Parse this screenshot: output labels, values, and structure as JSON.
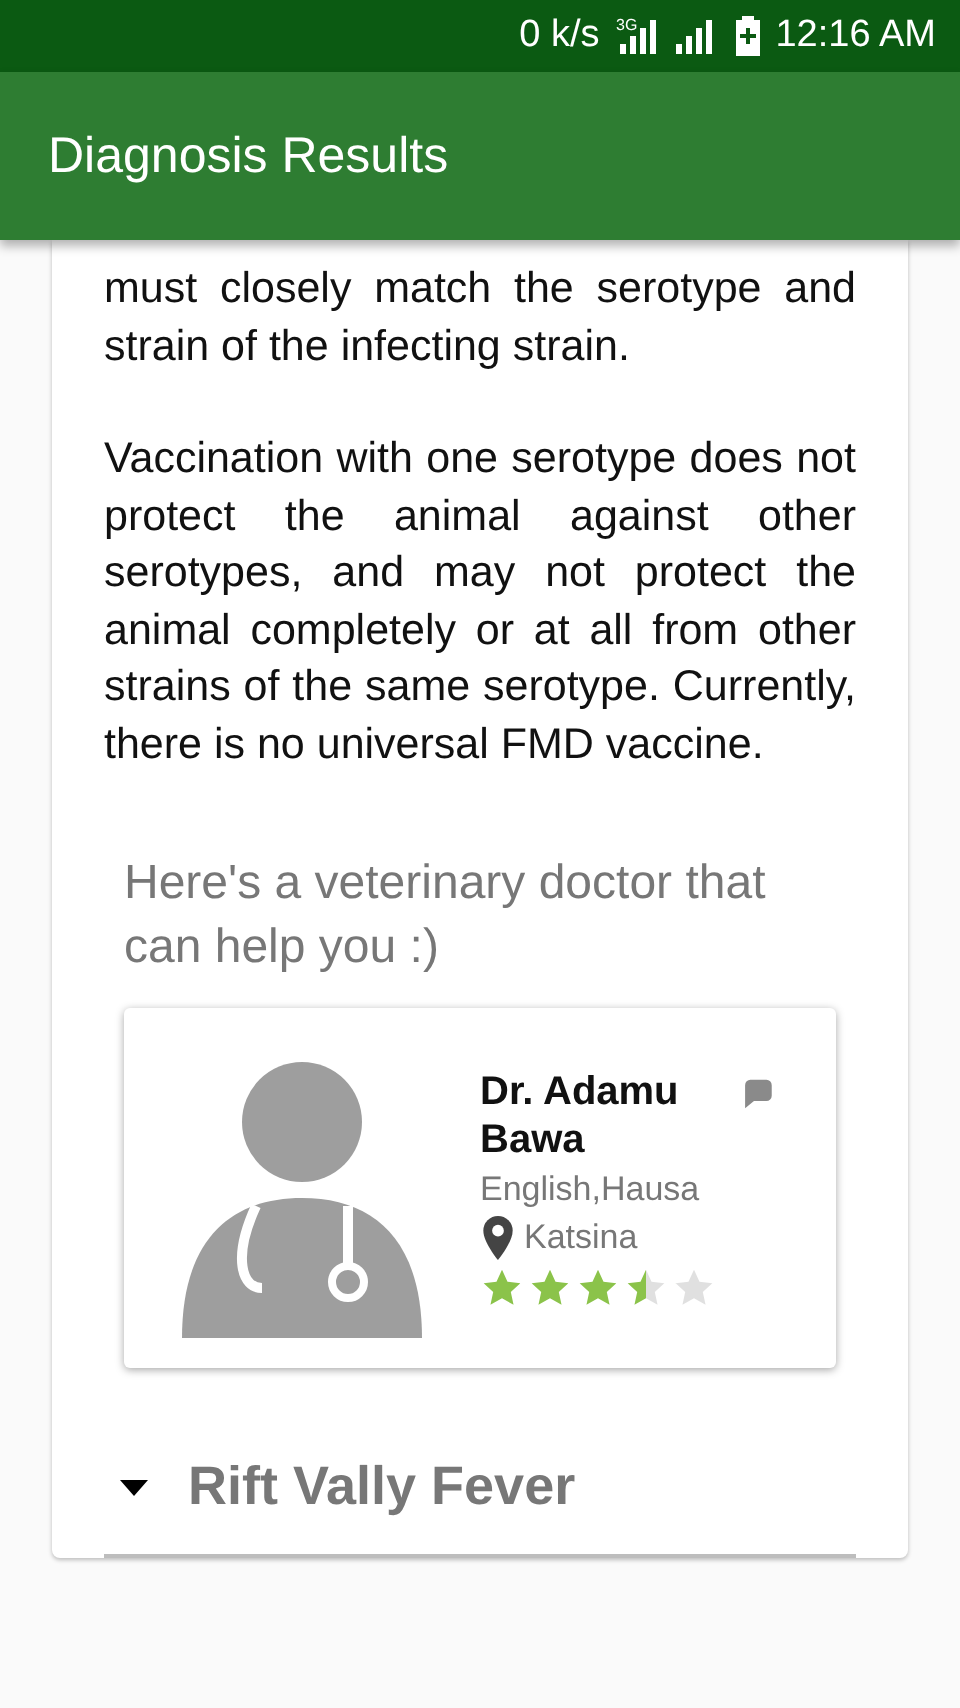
{
  "status_bar": {
    "speed": "0 k/s",
    "network": "3G",
    "time": "12:16 AM"
  },
  "app_bar": {
    "title": "Diagnosis Results"
  },
  "paragraphs": [
    "must closely match the serotype and strain of the infecting strain.",
    "Vaccination with one serotype does not protect the animal against other serotypes, and may not protect the animal completely or at all from other strains of the same serotype. Currently, there is no universal FMD vaccine."
  ],
  "doctor_section": {
    "heading": "Here's a veterinary doctor that can help you :)",
    "doctor": {
      "name": "Dr. Adamu Bawa",
      "languages": "English,Hausa",
      "location": "Katsina",
      "stars": 3.5
    }
  },
  "diseases": [
    {
      "name": "Rift Vally Fever",
      "expanded": false
    }
  ]
}
